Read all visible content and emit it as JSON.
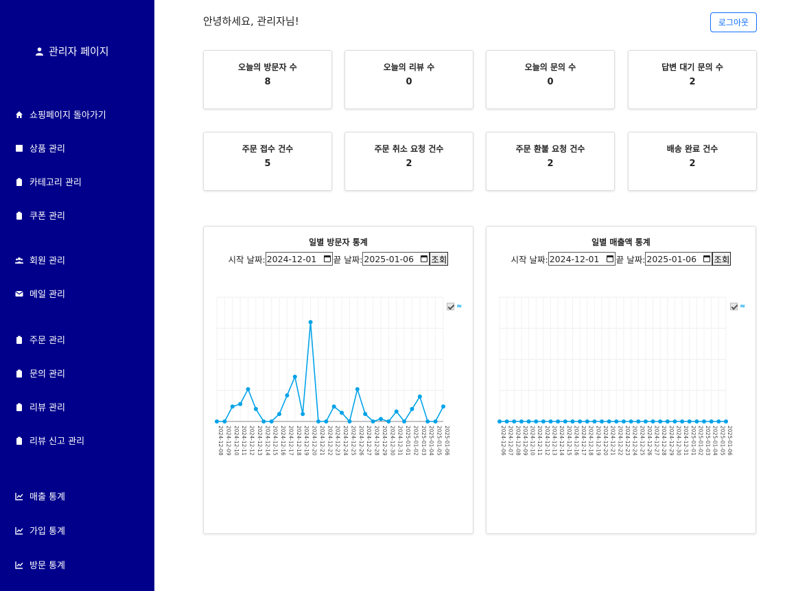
{
  "sidebar": {
    "title": "관리자 페이지",
    "items": [
      {
        "label": "쇼핑페이지 돌아가기",
        "icon": "home-icon"
      },
      {
        "label": "상품 관리",
        "icon": "box-icon"
      },
      {
        "label": "카테고리 관리",
        "icon": "clipboard-icon"
      },
      {
        "label": "쿠폰 관리",
        "icon": "clipboard-icon"
      },
      {
        "label": "회원 관리",
        "icon": "users-icon"
      },
      {
        "label": "메일 관리",
        "icon": "envelope-icon"
      },
      {
        "label": "주문 관리",
        "icon": "clipboard-icon"
      },
      {
        "label": "문의 관리",
        "icon": "clipboard-icon"
      },
      {
        "label": "리뷰 관리",
        "icon": "clipboard-icon"
      },
      {
        "label": "리뷰 신고 관리",
        "icon": "clipboard-icon"
      },
      {
        "label": "매출 통계",
        "icon": "chart-line-icon"
      },
      {
        "label": "가입 통계",
        "icon": "chart-line-icon"
      },
      {
        "label": "방문 통계",
        "icon": "chart-line-icon"
      }
    ]
  },
  "header": {
    "greeting": "안녕하세요, 관리자님!",
    "logout_label": "로그아웃"
  },
  "stats_row1": [
    {
      "label": "오늘의 방문자 수",
      "value": "8"
    },
    {
      "label": "오늘의 리뷰 수",
      "value": "0"
    },
    {
      "label": "오늘의 문의 수",
      "value": "0"
    },
    {
      "label": "답변 대기 문의 수",
      "value": "2"
    }
  ],
  "stats_row2": [
    {
      "label": "주문 접수 건수",
      "value": "5"
    },
    {
      "label": "주문 취소 요청 건수",
      "value": "2"
    },
    {
      "label": "주문 환불 요청 건수",
      "value": "2"
    },
    {
      "label": "배송 완료 건수",
      "value": "2"
    }
  ],
  "visitor_panel": {
    "title": "일별 방문자 통계",
    "start_label": "시작 날짜:",
    "start_value": "2024-12-01",
    "end_label": "끝 날짜:",
    "end_value": "2025-01-06",
    "query_label": "조회",
    "legend_label": "≈"
  },
  "sales_panel": {
    "title": "일별 매출액 통계",
    "start_label": "시작 날짜:",
    "start_value": "2024-12-01",
    "end_label": "끝 날짜:",
    "end_value": "2025-01-06",
    "query_label": "조회",
    "legend_label": "≈"
  },
  "colors": {
    "sidebar_bg": "#00008b",
    "accent": "#0d6efd",
    "series": "#00a2e8"
  },
  "chart_data": [
    {
      "type": "line",
      "title": "일별 방문자 통계",
      "x": [
        "2024-12-08",
        "2024-12-09",
        "2024-12-10",
        "2024-12-11",
        "2024-12-12",
        "2024-12-13",
        "2024-12-14",
        "2024-12-15",
        "2024-12-16",
        "2024-12-17",
        "2024-12-18",
        "2024-12-19",
        "2024-12-20",
        "2024-12-21",
        "2024-12-22",
        "2024-12-23",
        "2024-12-24",
        "2024-12-25",
        "2024-12-26",
        "2024-12-27",
        "2024-12-28",
        "2024-12-29",
        "2024-12-30",
        "2024-12-31",
        "2025-01-01",
        "2025-01-02",
        "2025-01-03",
        "2025-01-04",
        "2025-01-05",
        "2025-01-06"
      ],
      "series": [
        {
          "name": "≈",
          "values": [
            0,
            0,
            1.2,
            1.4,
            2.6,
            1.0,
            0,
            0,
            0.6,
            2.1,
            3.6,
            0.6,
            8.0,
            0,
            0,
            1.2,
            0.7,
            0,
            2.6,
            0.6,
            0,
            0.2,
            0,
            0.8,
            0,
            1.0,
            2.0,
            0,
            0,
            1.2
          ]
        }
      ],
      "ylim": [
        0,
        10
      ],
      "grid": true,
      "legend": "top-right"
    },
    {
      "type": "line",
      "title": "일별 매출액 통계",
      "x": [
        "2024-12-06",
        "2024-12-07",
        "2024-12-08",
        "2024-12-09",
        "2024-12-10",
        "2024-12-11",
        "2024-12-12",
        "2024-12-13",
        "2024-12-14",
        "2024-12-15",
        "2024-12-16",
        "2024-12-17",
        "2024-12-18",
        "2024-12-19",
        "2024-12-20",
        "2024-12-21",
        "2024-12-22",
        "2024-12-23",
        "2024-12-24",
        "2024-12-25",
        "2024-12-26",
        "2024-12-27",
        "2024-12-28",
        "2024-12-29",
        "2024-12-30",
        "2024-12-31",
        "2025-01-01",
        "2025-01-02",
        "2025-01-03",
        "2025-01-04",
        "2025-01-05",
        "2025-01-06"
      ],
      "series": [
        {
          "name": "≈",
          "values": [
            0,
            0,
            0,
            0,
            0,
            0,
            0,
            0,
            0,
            0,
            0,
            0,
            0,
            0,
            0,
            0,
            0,
            0,
            0,
            0,
            0,
            0,
            0,
            0,
            0,
            0,
            0,
            0,
            0,
            0,
            0,
            0
          ]
        }
      ],
      "ylim": [
        0,
        10
      ],
      "grid": true,
      "legend": "top-right"
    }
  ]
}
